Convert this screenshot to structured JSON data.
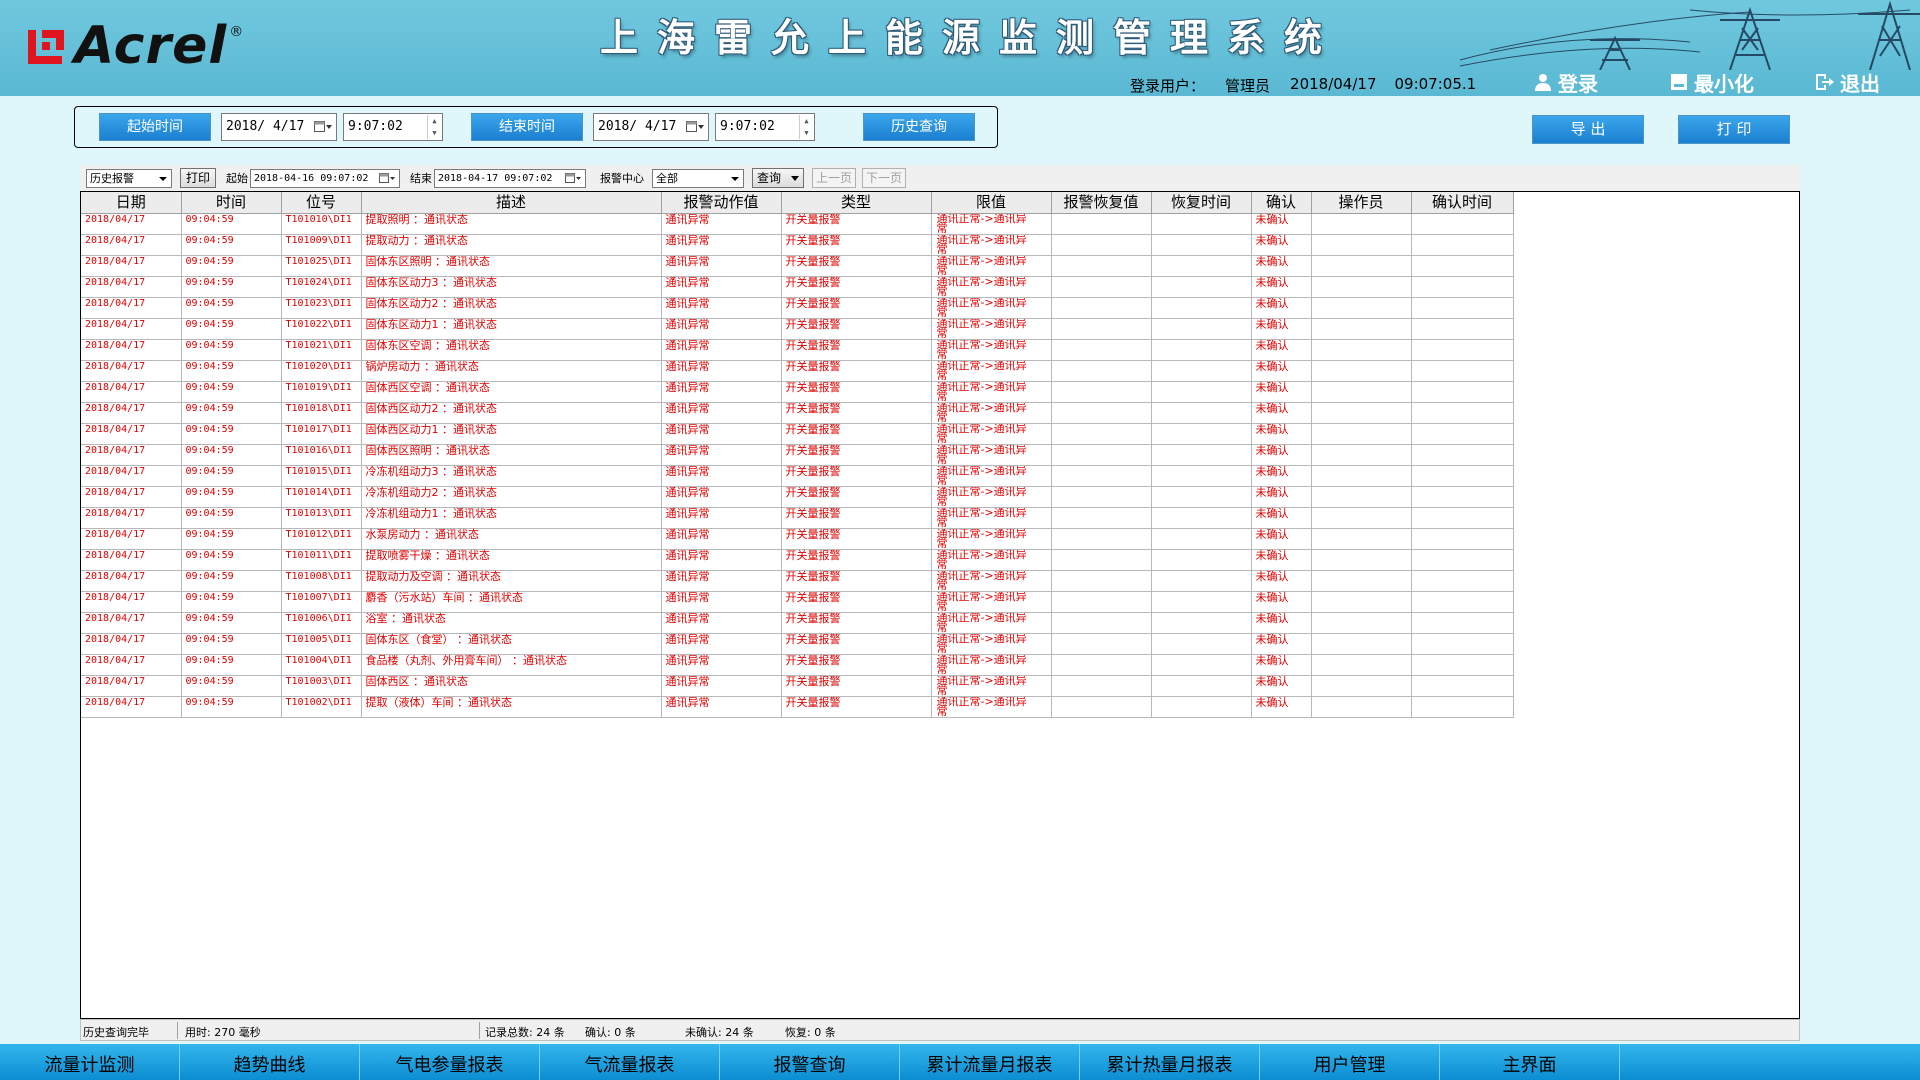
{
  "header": {
    "logo_text": "Acrel",
    "logo_mark": "®",
    "system_title": "上海雷允上能源监测管理系统",
    "user_label": "登录用户：",
    "user_name": "管理员",
    "date": "2018/04/17",
    "time": "09:07:05.1",
    "login_label": "登录",
    "minimize_label": "最小化",
    "exit_label": "退出"
  },
  "query": {
    "start_btn": "起始时间",
    "start_date": "2018/ 4/17",
    "start_time": "9:07:02",
    "end_btn": "结束时间",
    "end_date": "2018/ 4/17",
    "end_time": "9:07:02",
    "history_btn": "历史查询",
    "export_btn": "导  出",
    "print_btn": "打  印"
  },
  "toolbar": {
    "mode": "历史报警",
    "print": "打印",
    "start_label": "起始",
    "start_value": "2018-04-16  09:07:02",
    "end_label": "结束",
    "end_value": "2018-04-17  09:07:02",
    "center_label": "报警中心",
    "center_value": "全部",
    "query": "查询",
    "prev": "上一页",
    "next": "下一页"
  },
  "table": {
    "columns": [
      "日期",
      "时间",
      "位号",
      "描述",
      "报警动作值",
      "类型",
      "限值",
      "报警恢复值",
      "恢复时间",
      "确认",
      "操作员",
      "确认时间"
    ],
    "rows": [
      [
        "2018/04/17",
        "09:04:59",
        "T101010\\DI1",
        "提取照明 ：通讯状态",
        "通讯异常",
        "开关量报警",
        "通讯正常->通讯异常",
        "",
        "",
        "未确认",
        "",
        ""
      ],
      [
        "2018/04/17",
        "09:04:59",
        "T101009\\DI1",
        "提取动力 ：通讯状态",
        "通讯异常",
        "开关量报警",
        "通讯正常->通讯异常",
        "",
        "",
        "未确认",
        "",
        ""
      ],
      [
        "2018/04/17",
        "09:04:59",
        "T101025\\DI1",
        "固体东区照明 ：通讯状态",
        "通讯异常",
        "开关量报警",
        "通讯正常->通讯异常",
        "",
        "",
        "未确认",
        "",
        ""
      ],
      [
        "2018/04/17",
        "09:04:59",
        "T101024\\DI1",
        "固体东区动力3 ：通讯状态",
        "通讯异常",
        "开关量报警",
        "通讯正常->通讯异常",
        "",
        "",
        "未确认",
        "",
        ""
      ],
      [
        "2018/04/17",
        "09:04:59",
        "T101023\\DI1",
        "固体东区动力2 ：通讯状态",
        "通讯异常",
        "开关量报警",
        "通讯正常->通讯异常",
        "",
        "",
        "未确认",
        "",
        ""
      ],
      [
        "2018/04/17",
        "09:04:59",
        "T101022\\DI1",
        "固体东区动力1 ：通讯状态",
        "通讯异常",
        "开关量报警",
        "通讯正常->通讯异常",
        "",
        "",
        "未确认",
        "",
        ""
      ],
      [
        "2018/04/17",
        "09:04:59",
        "T101021\\DI1",
        "固体东区空调 ：通讯状态",
        "通讯异常",
        "开关量报警",
        "通讯正常->通讯异常",
        "",
        "",
        "未确认",
        "",
        ""
      ],
      [
        "2018/04/17",
        "09:04:59",
        "T101020\\DI1",
        "锅炉房动力 ：通讯状态",
        "通讯异常",
        "开关量报警",
        "通讯正常->通讯异常",
        "",
        "",
        "未确认",
        "",
        ""
      ],
      [
        "2018/04/17",
        "09:04:59",
        "T101019\\DI1",
        "固体西区空调 ：通讯状态",
        "通讯异常",
        "开关量报警",
        "通讯正常->通讯异常",
        "",
        "",
        "未确认",
        "",
        ""
      ],
      [
        "2018/04/17",
        "09:04:59",
        "T101018\\DI1",
        "固体西区动力2 ：通讯状态",
        "通讯异常",
        "开关量报警",
        "通讯正常->通讯异常",
        "",
        "",
        "未确认",
        "",
        ""
      ],
      [
        "2018/04/17",
        "09:04:59",
        "T101017\\DI1",
        "固体西区动力1 ：通讯状态",
        "通讯异常",
        "开关量报警",
        "通讯正常->通讯异常",
        "",
        "",
        "未确认",
        "",
        ""
      ],
      [
        "2018/04/17",
        "09:04:59",
        "T101016\\DI1",
        "固体西区照明 ：通讯状态",
        "通讯异常",
        "开关量报警",
        "通讯正常->通讯异常",
        "",
        "",
        "未确认",
        "",
        ""
      ],
      [
        "2018/04/17",
        "09:04:59",
        "T101015\\DI1",
        "冷冻机组动力3 ：通讯状态",
        "通讯异常",
        "开关量报警",
        "通讯正常->通讯异常",
        "",
        "",
        "未确认",
        "",
        ""
      ],
      [
        "2018/04/17",
        "09:04:59",
        "T101014\\DI1",
        "冷冻机组动力2 ：通讯状态",
        "通讯异常",
        "开关量报警",
        "通讯正常->通讯异常",
        "",
        "",
        "未确认",
        "",
        ""
      ],
      [
        "2018/04/17",
        "09:04:59",
        "T101013\\DI1",
        "冷冻机组动力1 ：通讯状态",
        "通讯异常",
        "开关量报警",
        "通讯正常->通讯异常",
        "",
        "",
        "未确认",
        "",
        ""
      ],
      [
        "2018/04/17",
        "09:04:59",
        "T101012\\DI1",
        "水泵房动力 ：通讯状态",
        "通讯异常",
        "开关量报警",
        "通讯正常->通讯异常",
        "",
        "",
        "未确认",
        "",
        ""
      ],
      [
        "2018/04/17",
        "09:04:59",
        "T101011\\DI1",
        "提取喷雾干燥 ：通讯状态",
        "通讯异常",
        "开关量报警",
        "通讯正常->通讯异常",
        "",
        "",
        "未确认",
        "",
        ""
      ],
      [
        "2018/04/17",
        "09:04:59",
        "T101008\\DI1",
        "提取动力及空调 ：通讯状态",
        "通讯异常",
        "开关量报警",
        "通讯正常->通讯异常",
        "",
        "",
        "未确认",
        "",
        ""
      ],
      [
        "2018/04/17",
        "09:04:59",
        "T101007\\DI1",
        "麝香（污水站）车间 ：通讯状态",
        "通讯异常",
        "开关量报警",
        "通讯正常->通讯异常",
        "",
        "",
        "未确认",
        "",
        ""
      ],
      [
        "2018/04/17",
        "09:04:59",
        "T101006\\DI1",
        "浴室 ：通讯状态",
        "通讯异常",
        "开关量报警",
        "通讯正常->通讯异常",
        "",
        "",
        "未确认",
        "",
        ""
      ],
      [
        "2018/04/17",
        "09:04:59",
        "T101005\\DI1",
        "固体东区（食堂） ：通讯状态",
        "通讯异常",
        "开关量报警",
        "通讯正常->通讯异常",
        "",
        "",
        "未确认",
        "",
        ""
      ],
      [
        "2018/04/17",
        "09:04:59",
        "T101004\\DI1",
        "食品楼（丸剂、外用膏车间） ：通讯状态",
        "通讯异常",
        "开关量报警",
        "通讯正常->通讯异常",
        "",
        "",
        "未确认",
        "",
        ""
      ],
      [
        "2018/04/17",
        "09:04:59",
        "T101003\\DI1",
        "固体西区 ：通讯状态",
        "通讯异常",
        "开关量报警",
        "通讯正常->通讯异常",
        "",
        "",
        "未确认",
        "",
        ""
      ],
      [
        "2018/04/17",
        "09:04:59",
        "T101002\\DI1",
        "提取（液体）车间 ：通讯状态",
        "通讯异常",
        "开关量报警",
        "通讯正常->通讯异常",
        "",
        "",
        "未确认",
        "",
        ""
      ]
    ]
  },
  "status": {
    "message": "历史查询完毕",
    "elapsed": "用时: 270 毫秒",
    "total": "记录总数: 24 条",
    "confirmed": "确认: 0 条",
    "unconfirmed": "未确认: 24 条",
    "recovered": "恢复: 0 条"
  },
  "nav": [
    "流量计监测",
    "趋势曲线",
    "气电参量报表",
    "气流量报表",
    "报警查询",
    "累计流量月报表",
    "累计热量月报表",
    "用户管理",
    "主界面"
  ],
  "colors": {
    "header_bg": "#5ab8d3",
    "alarm_text": "#e00000",
    "button_blue": "#1b7fd0",
    "nav_bg": "#0b8dd2",
    "logo_red": "#e0141e"
  },
  "icons": {
    "login": "user-icon",
    "minimize": "minimize-icon",
    "exit": "exit-icon",
    "calendar": "calendar-icon"
  }
}
